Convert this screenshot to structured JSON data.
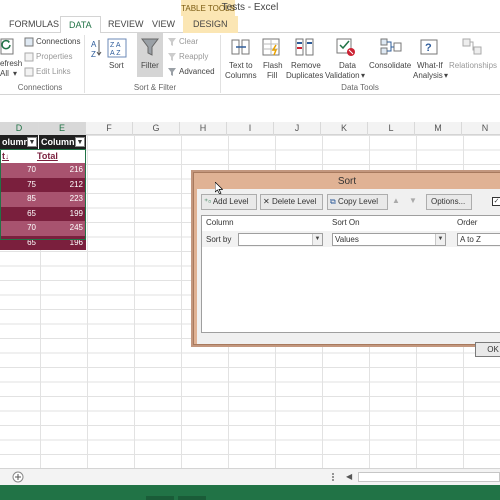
{
  "window": {
    "title": "Tests - Excel",
    "contextual_label": "TABLE TOOLS"
  },
  "tabs": [
    {
      "label": "FORMULAS"
    },
    {
      "label": "DATA"
    },
    {
      "label": "REVIEW"
    },
    {
      "label": "VIEW"
    },
    {
      "label": "DESIGN"
    }
  ],
  "ribbon": {
    "connections": {
      "refresh_l1": "efresh",
      "refresh_l2": "All",
      "connections": "Connections",
      "properties": "Properties",
      "edit_links": "Edit Links",
      "group": "Connections"
    },
    "sort_filter": {
      "sort": "Sort",
      "filter": "Filter",
      "clear": "Clear",
      "reapply": "Reapply",
      "advanced": "Advanced",
      "group": "Sort & Filter"
    },
    "data_tools": {
      "text_to_columns_l1": "Text to",
      "text_to_columns_l2": "Columns",
      "flash_fill_l1": "Flash",
      "flash_fill_l2": "Fill",
      "remove_duplicates_l1": "Remove",
      "remove_duplicates_l2": "Duplicates",
      "data_validation_l1": "Data",
      "data_validation_l2": "Validation",
      "consolidate": "Consolidate",
      "whatif_l1": "What-If",
      "whatif_l2": "Analysis",
      "relationships": "Relationships",
      "group": "Data Tools"
    }
  },
  "columns": [
    "D",
    "E",
    "F",
    "G",
    "H",
    "I",
    "J",
    "K",
    "L",
    "M",
    "N"
  ],
  "table": {
    "headers": [
      "olumn",
      "Column"
    ],
    "summary_row": [
      "t",
      "Total"
    ],
    "rows": [
      [
        "70",
        "216"
      ],
      [
        "75",
        "212"
      ],
      [
        "85",
        "223"
      ],
      [
        "65",
        "199"
      ],
      [
        "70",
        "245"
      ],
      [
        "65",
        "196"
      ]
    ]
  },
  "dialog": {
    "title": "Sort",
    "add_level": "Add Level",
    "delete_level": "Delete Level",
    "copy_level": "Copy Level",
    "options": "Options...",
    "col_header": "Column",
    "sorton_header": "Sort On",
    "order_header": "Order",
    "sort_by_label": "Sort by",
    "sort_by_value": "",
    "sort_on_value": "Values",
    "order_value": "A to Z",
    "ok": "OK"
  },
  "colors": {
    "accent": "#217346",
    "table_row_dark": "#7a1f3d",
    "table_row_light": "#a8536f",
    "dialog_frame": "#e0b294"
  }
}
